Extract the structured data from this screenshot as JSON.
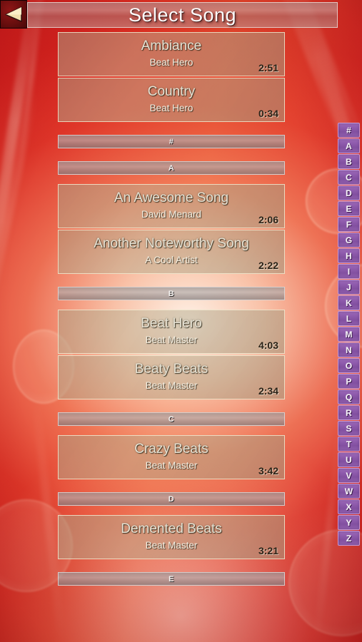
{
  "app": {
    "title": "Select Song",
    "back_icon": "back-arrow-icon"
  },
  "alphabet": {
    "letters": [
      "#",
      "A",
      "B",
      "C",
      "D",
      "E",
      "F",
      "G",
      "H",
      "I",
      "J",
      "K",
      "L",
      "M",
      "N",
      "O",
      "P",
      "Q",
      "R",
      "S",
      "T",
      "U",
      "V",
      "W",
      "X",
      "Y",
      "Z"
    ],
    "accent_color": "#8f5bad",
    "border_color": "#c49ad8"
  },
  "list": {
    "sections": [
      {
        "id": "top",
        "divider": null,
        "songs": [
          {
            "title": "Ambiance",
            "artist": "Beat Hero",
            "duration": "2:51"
          },
          {
            "title": "Country",
            "artist": "Beat Hero",
            "duration": "0:34"
          }
        ]
      },
      {
        "id": "hash",
        "divider": "#",
        "songs": []
      },
      {
        "id": "a",
        "divider": "A",
        "songs": [
          {
            "title": "An Awesome Song",
            "artist": "David Menard",
            "duration": "2:06"
          },
          {
            "title": "Another Noteworthy Song",
            "artist": "A Cool Artist",
            "duration": "2:22"
          }
        ]
      },
      {
        "id": "b",
        "divider": "B",
        "songs": [
          {
            "title": "Beat Hero",
            "artist": "Beat Master",
            "duration": "4:03"
          },
          {
            "title": "Beaty Beats",
            "artist": "Beat Master",
            "duration": "2:34"
          }
        ]
      },
      {
        "id": "c",
        "divider": "C",
        "songs": [
          {
            "title": "Crazy Beats",
            "artist": "Beat Master",
            "duration": "3:42"
          }
        ]
      },
      {
        "id": "d",
        "divider": "D",
        "songs": [
          {
            "title": "Demented Beats",
            "artist": "Beat Master",
            "duration": "3:21"
          }
        ]
      },
      {
        "id": "e",
        "divider": "E",
        "songs": []
      }
    ]
  },
  "theme": {
    "background_red": "#d62020",
    "background_highlight": "#fff8ee",
    "row_border": "#f6f0d6"
  }
}
